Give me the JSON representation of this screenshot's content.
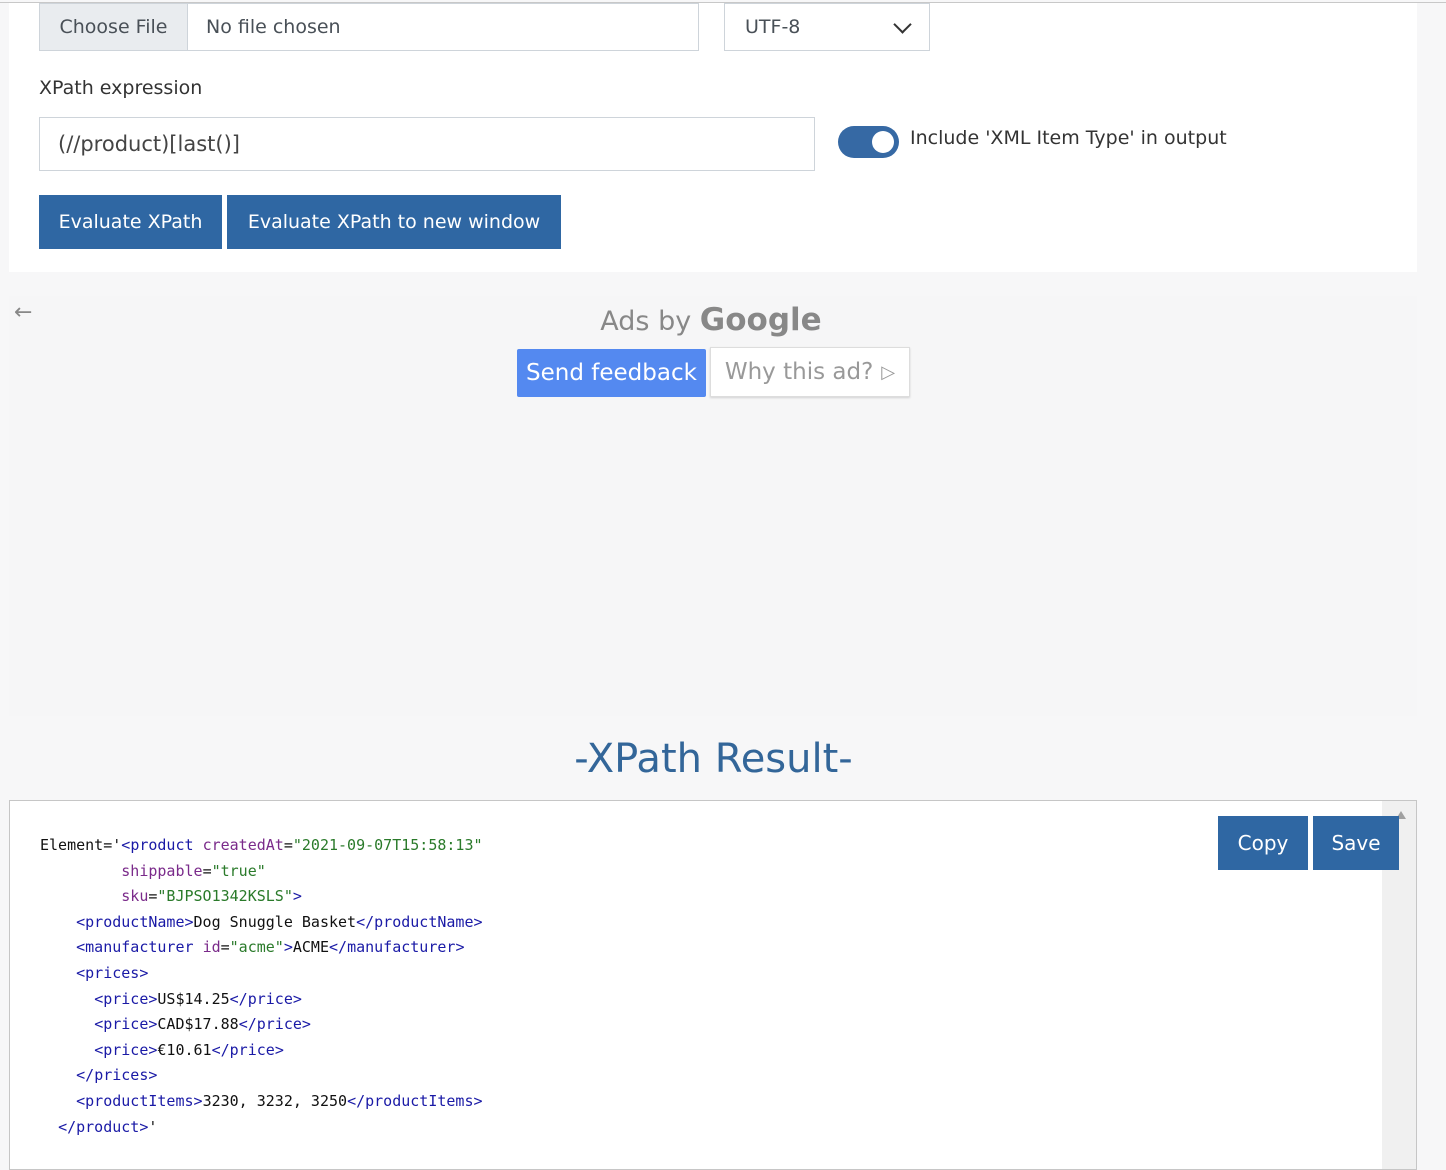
{
  "form": {
    "file_button": "Choose File",
    "file_status": "No file chosen",
    "encoding": "UTF-8",
    "xpath_label": "XPath expression",
    "xpath_value": "(//product)[last()]",
    "toggle_label": "Include 'XML Item Type' in output",
    "toggle_on": true,
    "evaluate_button": "Evaluate XPath",
    "evaluate_new_window_button": "Evaluate XPath to new window"
  },
  "ad": {
    "back_icon": "arrow-left-icon",
    "ads_by": "Ads by",
    "ads_brand": "Google",
    "feedback_button": "Send feedback",
    "why_button": "Why this ad?",
    "why_icon": "play-outline-icon"
  },
  "result": {
    "title": "-XPath Result-",
    "copy_button": "Copy",
    "save_button": "Save",
    "lines": [
      [
        [
          "t",
          "Element='"
        ],
        [
          "p",
          "<"
        ],
        [
          "g",
          "product"
        ],
        [
          "t",
          " "
        ],
        [
          "a",
          "createdAt"
        ],
        [
          "t",
          "="
        ],
        [
          "v",
          "\"2021-09-07T15:58:13\""
        ]
      ],
      [
        [
          "t",
          "         "
        ],
        [
          "a",
          "shippable"
        ],
        [
          "t",
          "="
        ],
        [
          "v",
          "\"true\""
        ]
      ],
      [
        [
          "t",
          "         "
        ],
        [
          "a",
          "sku"
        ],
        [
          "t",
          "="
        ],
        [
          "v",
          "\"BJPSO1342KSLS\""
        ],
        [
          "p",
          ">"
        ]
      ],
      [
        [
          "t",
          "    "
        ],
        [
          "p",
          "<"
        ],
        [
          "g",
          "productName"
        ],
        [
          "p",
          ">"
        ],
        [
          "t",
          "Dog Snuggle Basket"
        ],
        [
          "p",
          "</"
        ],
        [
          "g",
          "productName"
        ],
        [
          "p",
          ">"
        ]
      ],
      [
        [
          "t",
          "    "
        ],
        [
          "p",
          "<"
        ],
        [
          "g",
          "manufacturer"
        ],
        [
          "t",
          " "
        ],
        [
          "a",
          "id"
        ],
        [
          "t",
          "="
        ],
        [
          "v",
          "\"acme\""
        ],
        [
          "p",
          ">"
        ],
        [
          "t",
          "ACME"
        ],
        [
          "p",
          "</"
        ],
        [
          "g",
          "manufacturer"
        ],
        [
          "p",
          ">"
        ]
      ],
      [
        [
          "t",
          "    "
        ],
        [
          "p",
          "<"
        ],
        [
          "g",
          "prices"
        ],
        [
          "p",
          ">"
        ]
      ],
      [
        [
          "t",
          "      "
        ],
        [
          "p",
          "<"
        ],
        [
          "g",
          "price"
        ],
        [
          "p",
          ">"
        ],
        [
          "t",
          "US$14.25"
        ],
        [
          "p",
          "</"
        ],
        [
          "g",
          "price"
        ],
        [
          "p",
          ">"
        ]
      ],
      [
        [
          "t",
          "      "
        ],
        [
          "p",
          "<"
        ],
        [
          "g",
          "price"
        ],
        [
          "p",
          ">"
        ],
        [
          "t",
          "CAD$17.88"
        ],
        [
          "p",
          "</"
        ],
        [
          "g",
          "price"
        ],
        [
          "p",
          ">"
        ]
      ],
      [
        [
          "t",
          "      "
        ],
        [
          "p",
          "<"
        ],
        [
          "g",
          "price"
        ],
        [
          "p",
          ">"
        ],
        [
          "t",
          "€10.61"
        ],
        [
          "p",
          "</"
        ],
        [
          "g",
          "price"
        ],
        [
          "p",
          ">"
        ]
      ],
      [
        [
          "t",
          "    "
        ],
        [
          "p",
          "</"
        ],
        [
          "g",
          "prices"
        ],
        [
          "p",
          ">"
        ]
      ],
      [
        [
          "t",
          "    "
        ],
        [
          "p",
          "<"
        ],
        [
          "g",
          "productItems"
        ],
        [
          "p",
          ">"
        ],
        [
          "t",
          "3230, 3232, 3250"
        ],
        [
          "p",
          "</"
        ],
        [
          "g",
          "productItems"
        ],
        [
          "p",
          ">"
        ]
      ],
      [
        [
          "t",
          "  "
        ],
        [
          "p",
          "</"
        ],
        [
          "g",
          "product"
        ],
        [
          "p",
          ">"
        ],
        [
          "t",
          "'"
        ]
      ]
    ]
  },
  "colors": {
    "primary": "#2f67a3",
    "feedback": "#5489f0",
    "title": "#336699",
    "tag": "#1a1aa6",
    "attribute": "#7a2a8a",
    "value": "#2a7a2a"
  }
}
